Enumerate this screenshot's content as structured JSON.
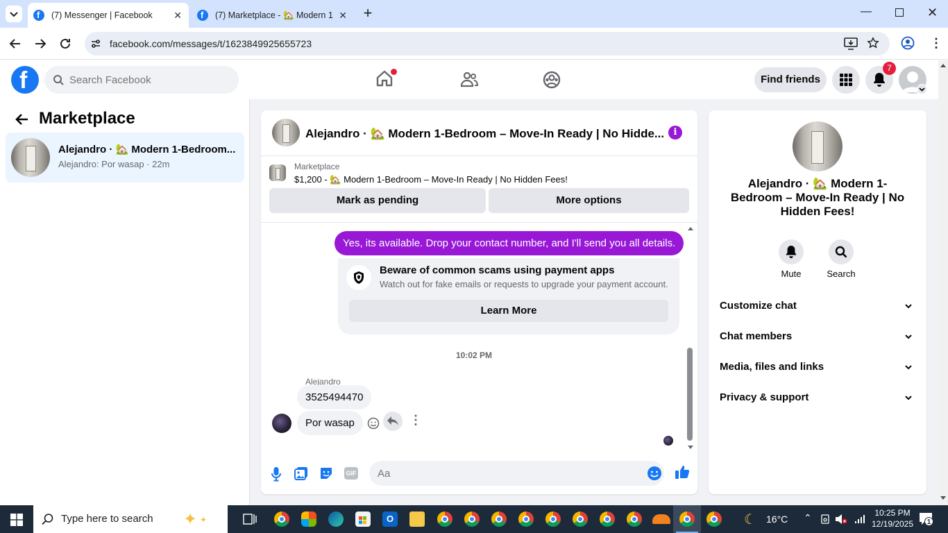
{
  "browser": {
    "tabs": [
      {
        "title": "(7) Messenger | Facebook",
        "active": true
      },
      {
        "title": "(7) Marketplace - 🏡 Modern 1",
        "active": false
      }
    ],
    "url": "facebook.com/messages/t/1623849925655723"
  },
  "fb_header": {
    "search_placeholder": "Search Facebook",
    "find_friends": "Find friends",
    "notifications_count": "7"
  },
  "left_panel": {
    "title": "Marketplace",
    "conversation": {
      "name": "Alejandro · 🏡 Modern 1-Bedroom...",
      "preview": "Alejandro: Por wasap · 22m"
    }
  },
  "chat": {
    "title": "Alejandro · 🏡 Modern 1-Bedroom – Move-In Ready | No Hidde...",
    "listing": {
      "label": "Marketplace",
      "price_title": "$1,200 - 🏡 Modern 1-Bedroom – Move-In Ready | No Hidden Fees!",
      "mark_pending": "Mark as pending",
      "more_options": "More options"
    },
    "outgoing_message": "Yes, its available. Drop your contact number, and I'll send you all details.",
    "scam_card": {
      "title": "Beware of common scams using payment apps",
      "body": "Watch out for fake emails or requests to upgrade your payment account.",
      "button": "Learn More"
    },
    "timestamp": "10:02 PM",
    "sender_name": "Alejandro",
    "incoming_messages": [
      "3525494470",
      "Por wasap"
    ],
    "composer_placeholder": "Aa"
  },
  "right_panel": {
    "title": "Alejandro · 🏡 Modern 1-Bedroom – Move-In Ready | No Hidden Fees!",
    "actions": [
      {
        "label": "Mute",
        "icon": "bell-icon"
      },
      {
        "label": "Search",
        "icon": "search-icon"
      }
    ],
    "sections": [
      "Customize chat",
      "Chat members",
      "Media, files and links",
      "Privacy & support"
    ]
  },
  "taskbar": {
    "search_placeholder": "Type here to search",
    "weather": "16°C",
    "time": "10:25 PM",
    "date": "12/19/2025",
    "notification_count": "1"
  },
  "colors": {
    "facebook_blue": "#1877f2",
    "outgoing_bubble": "#9818d6",
    "badge_red": "#e41e3f",
    "selected_conv": "#ebf5ff"
  }
}
